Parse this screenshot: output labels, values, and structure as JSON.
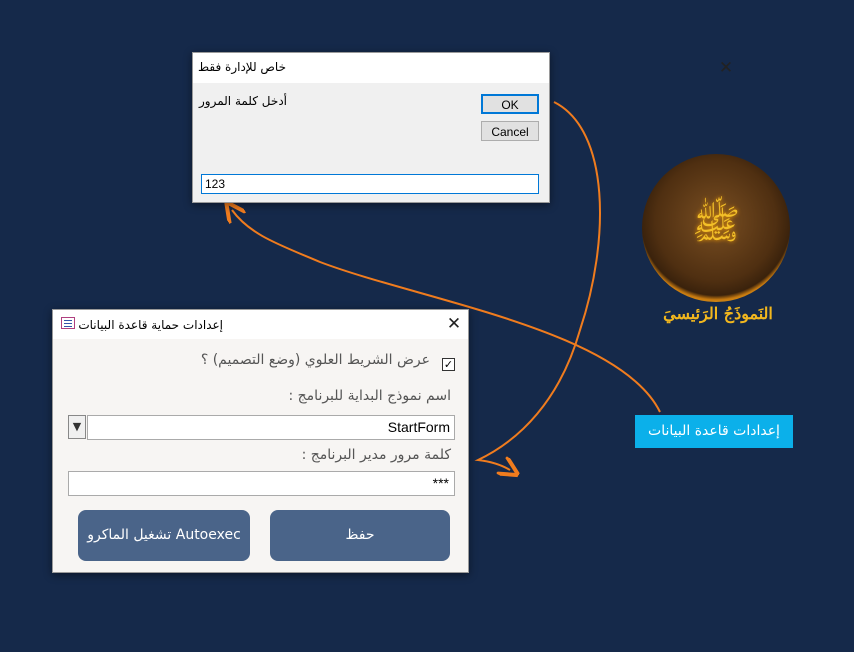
{
  "password_dialog": {
    "title": "خاص للإدارة فقط",
    "prompt": "أدخل كلمة المرور",
    "ok_label": "OK",
    "cancel_label": "Cancel",
    "input_value": "123"
  },
  "security_dialog": {
    "title": "إعدادات حماية قاعدة البيانات",
    "show_toolbar_label": "عرض الشريط العلوي (وضع التصميم) ؟",
    "show_toolbar_checked": true,
    "startup_form_label": "اسم نموذج البداية للبرنامج :",
    "startup_form_value": "StartForm",
    "admin_password_label": "كلمة مرور مدير البرنامج :",
    "admin_password_value": "***",
    "run_macro_label": "تشغيل الماكرو Autoexec",
    "save_label": "حفظ"
  },
  "main": {
    "logo_icon": "golden-emblem-icon",
    "main_form_label": "النَموذَجُ الرَئيسيَ",
    "db_settings_button": "إعدادات قاعدة البيانات"
  },
  "colors": {
    "background": "#15294a",
    "accent_button": "#0bb0ea",
    "arrow": "#f07c1e",
    "dialog_button": "#4a6489"
  }
}
